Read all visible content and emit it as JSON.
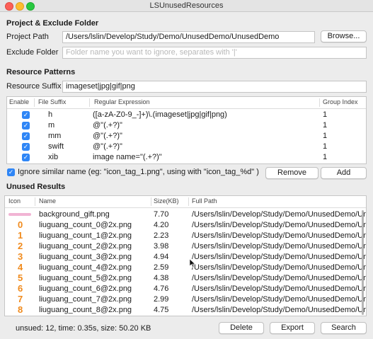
{
  "window": {
    "title": "LSUnusedResources"
  },
  "project": {
    "section_title": "Project & Exclude Folder",
    "path_label": "Project Path",
    "path_value": "/Users/lslin/Develop/Study/Demo/UnusedDemo/UnusedDemo",
    "browse_label": "Browse...",
    "exclude_label": "Exclude Folder",
    "exclude_placeholder": "Folder name you want to ignore, separates with '|'"
  },
  "patterns": {
    "section_title": "Resource Patterns",
    "suffix_label": "Resource Suffix",
    "suffix_value": "imageset|jpg|gif|png",
    "columns": [
      "Enable",
      "File Suffix",
      "Regular Expression",
      "Group Index"
    ],
    "rows": [
      {
        "enabled": true,
        "suffix": "h",
        "regex": "([a-zA-Z0-9_-]+)\\.(imageset|jpg|gif|png)",
        "group": "1"
      },
      {
        "enabled": true,
        "suffix": "m",
        "regex": "@\"(.+?)\"",
        "group": "1"
      },
      {
        "enabled": true,
        "suffix": "mm",
        "regex": "@\"(.+?)\"",
        "group": "1"
      },
      {
        "enabled": true,
        "suffix": "swift",
        "regex": "@\"(.+?)\"",
        "group": "1"
      },
      {
        "enabled": true,
        "suffix": "xib",
        "regex": "image name=\"(.+?)\"",
        "group": "1"
      }
    ],
    "ignore_checked": true,
    "ignore_label": "Ignore similar name (eg: \"icon_tag_1.png\", using with \"icon_tag_%d\" )",
    "remove_label": "Remove",
    "add_label": "Add"
  },
  "results": {
    "section_title": "Unused Results",
    "columns": [
      "Icon",
      "Name",
      "Size(KB)",
      "Full Path"
    ],
    "rows": [
      {
        "icon": "",
        "name": "background_gift.png",
        "size": "7.70",
        "path": "/Users/lslin/Develop/Study/Demo/UnusedDemo/UnusedDemo"
      },
      {
        "icon": "0",
        "name": "liuguang_count_0@2x.png",
        "size": "4.20",
        "path": "/Users/lslin/Develop/Study/Demo/UnusedDemo/UnusedDemo"
      },
      {
        "icon": "1",
        "name": "liuguang_count_1@2x.png",
        "size": "2.23",
        "path": "/Users/lslin/Develop/Study/Demo/UnusedDemo/UnusedDemo"
      },
      {
        "icon": "2",
        "name": "liuguang_count_2@2x.png",
        "size": "3.98",
        "path": "/Users/lslin/Develop/Study/Demo/UnusedDemo/UnusedDemo"
      },
      {
        "icon": "3",
        "name": "liuguang_count_3@2x.png",
        "size": "4.94",
        "path": "/Users/lslin/Develop/Study/Demo/UnusedDemo/UnusedDemo"
      },
      {
        "icon": "4",
        "name": "liuguang_count_4@2x.png",
        "size": "2.59",
        "path": "/Users/lslin/Develop/Study/Demo/UnusedDemo/UnusedDemo"
      },
      {
        "icon": "5",
        "name": "liuguang_count_5@2x.png",
        "size": "4.38",
        "path": "/Users/lslin/Develop/Study/Demo/UnusedDemo/UnusedDemo"
      },
      {
        "icon": "6",
        "name": "liuguang_count_6@2x.png",
        "size": "4.76",
        "path": "/Users/lslin/Develop/Study/Demo/UnusedDemo/UnusedDemo"
      },
      {
        "icon": "7",
        "name": "liuguang_count_7@2x.png",
        "size": "2.99",
        "path": "/Users/lslin/Develop/Study/Demo/UnusedDemo/UnusedDemo"
      },
      {
        "icon": "8",
        "name": "liuguang_count_8@2x.png",
        "size": "4.75",
        "path": "/Users/lslin/Develop/Study/Demo/UnusedDemo/UnusedDemo"
      }
    ]
  },
  "footer": {
    "status": "unsued: 12, time: 0.35s, size: 50.20 KB",
    "delete_label": "Delete",
    "export_label": "Export",
    "search_label": "Search"
  },
  "colors": {
    "accent": "#2f86f6",
    "icon_orange": "#f08a1c"
  },
  "icons": {
    "checkbox": "checkmark",
    "gift_icon": "pink-bar-thumbnail"
  }
}
